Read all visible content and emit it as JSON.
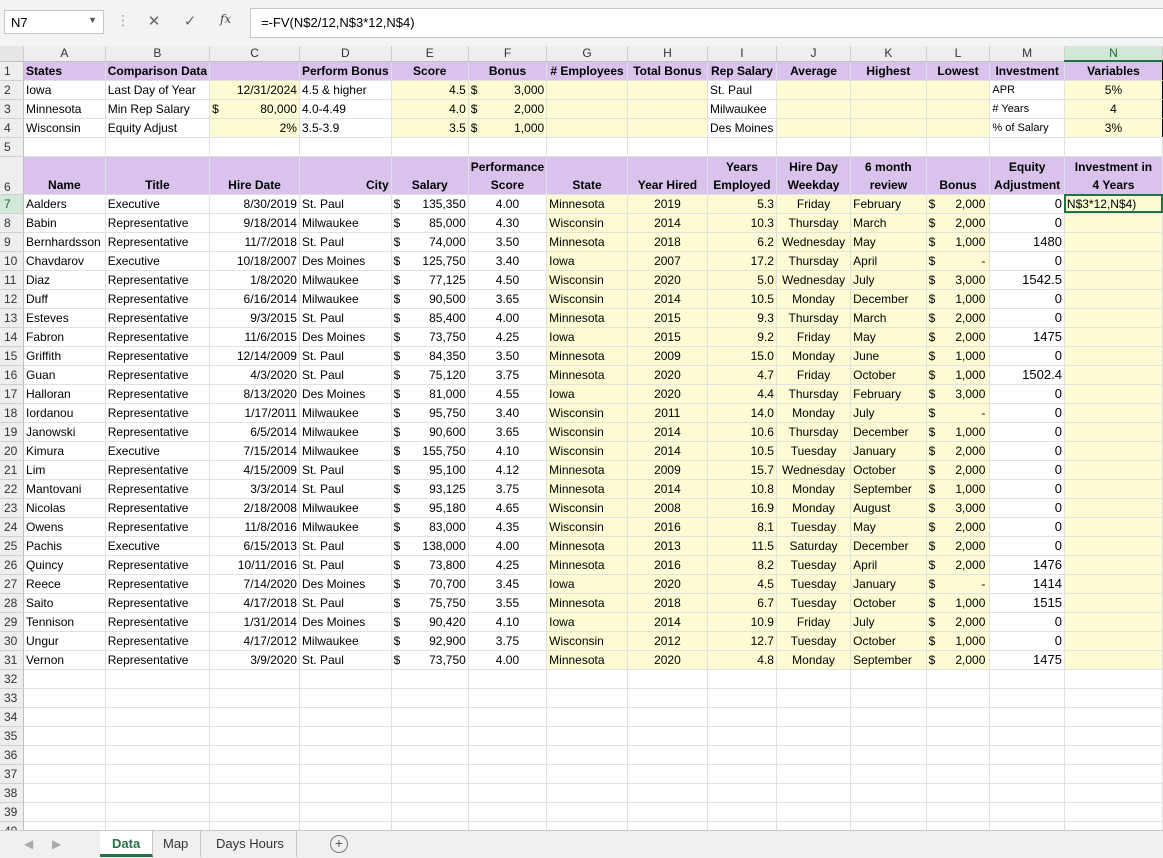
{
  "formula_bar": {
    "name_box": "N7",
    "formula": "=-FV(N$2/12,N$3*12,N$4)"
  },
  "columns": [
    "A",
    "B",
    "C",
    "D",
    "E",
    "F",
    "G",
    "H",
    "I",
    "J",
    "K",
    "L",
    "M",
    "N"
  ],
  "selected_column": "N",
  "selected_row": "7",
  "rows": {
    "r1": {
      "a": "States",
      "b": "Comparison Data",
      "d": "Perform Bonus",
      "e": "Score",
      "f": "Bonus",
      "g": "# Employees",
      "h": "Total Bonus",
      "i": "Rep Salary",
      "j": "Average",
      "k": "Highest",
      "l": "Lowest",
      "m": "Investment",
      "n": "Variables"
    },
    "r2": {
      "a": "Iowa",
      "b": "Last Day of Year",
      "c": "12/31/2024",
      "d": "4.5 & higher",
      "e": "4.5",
      "f_sym": "$",
      "f": "3,000",
      "i": "St. Paul",
      "m": "APR",
      "n": "5%"
    },
    "r3": {
      "a": "Minnesota",
      "b": "Min Rep Salary",
      "c_sym": "$",
      "c": "80,000",
      "d": "4.0-4.49",
      "e": "4.0",
      "f_sym": "$",
      "f": "2,000",
      "i": "Milwaukee",
      "m": "# Years",
      "n": "4"
    },
    "r4": {
      "a": "Wisconsin",
      "b": "Equity Adjust",
      "c": "2%",
      "d": "3.5-3.9",
      "e": "3.5",
      "f_sym": "$",
      "f": "1,000",
      "i": "Des Moines",
      "m": "% of Salary",
      "n": "3%"
    }
  },
  "header6": {
    "a": "Name",
    "b": "Title",
    "c": "Hire Date",
    "d": "City",
    "e": "Salary",
    "f1": "Performance",
    "f2": "Score",
    "g": "State",
    "h": "Year Hired",
    "i1": "Years",
    "i2": "Employed",
    "j1": "Hire Day",
    "j2": "Weekday",
    "k1": "6 month",
    "k2": "review",
    "l": "Bonus",
    "m1": "Equity",
    "m2": "Adjustment",
    "n1": "Investment in",
    "n2": "4 Years"
  },
  "data": [
    {
      "row": "7",
      "name": "Aalders",
      "title": "Executive",
      "hire": "8/30/2019",
      "city": "St. Paul",
      "salary": "135,350",
      "score": "4.00",
      "state": "Minnesota",
      "year": "2019",
      "years": "5.3",
      "weekday": "Friday",
      "review": "February",
      "bonus": "2,000",
      "equity": "0",
      "inv": "N$3*12,N$4)"
    },
    {
      "row": "8",
      "name": "Babin",
      "title": "Representative",
      "hire": "9/18/2014",
      "city": "Milwaukee",
      "salary": "85,000",
      "score": "4.30",
      "state": "Wisconsin",
      "year": "2014",
      "years": "10.3",
      "weekday": "Thursday",
      "review": "March",
      "bonus": "2,000",
      "equity": "0",
      "inv": ""
    },
    {
      "row": "9",
      "name": "Bernhardsson",
      "title": "Representative",
      "hire": "11/7/2018",
      "city": "St. Paul",
      "salary": "74,000",
      "score": "3.50",
      "state": "Minnesota",
      "year": "2018",
      "years": "6.2",
      "weekday": "Wednesday",
      "review": "May",
      "bonus": "1,000",
      "equity": "1480",
      "inv": ""
    },
    {
      "row": "10",
      "name": "Chavdarov",
      "title": "Executive",
      "hire": "10/18/2007",
      "city": "Des Moines",
      "salary": "125,750",
      "score": "3.40",
      "state": "Iowa",
      "year": "2007",
      "years": "17.2",
      "weekday": "Thursday",
      "review": "April",
      "bonus": "-",
      "equity": "0",
      "inv": ""
    },
    {
      "row": "11",
      "name": "Diaz",
      "title": "Representative",
      "hire": "1/8/2020",
      "city": "Milwaukee",
      "salary": "77,125",
      "score": "4.50",
      "state": "Wisconsin",
      "year": "2020",
      "years": "5.0",
      "weekday": "Wednesday",
      "review": "July",
      "bonus": "3,000",
      "equity": "1542.5",
      "inv": ""
    },
    {
      "row": "12",
      "name": "Duff",
      "title": "Representative",
      "hire": "6/16/2014",
      "city": "Milwaukee",
      "salary": "90,500",
      "score": "3.65",
      "state": "Wisconsin",
      "year": "2014",
      "years": "10.5",
      "weekday": "Monday",
      "review": "December",
      "bonus": "1,000",
      "equity": "0",
      "inv": ""
    },
    {
      "row": "13",
      "name": "Esteves",
      "title": "Representative",
      "hire": "9/3/2015",
      "city": "St. Paul",
      "salary": "85,400",
      "score": "4.00",
      "state": "Minnesota",
      "year": "2015",
      "years": "9.3",
      "weekday": "Thursday",
      "review": "March",
      "bonus": "2,000",
      "equity": "0",
      "inv": ""
    },
    {
      "row": "14",
      "name": "Fabron",
      "title": "Representative",
      "hire": "11/6/2015",
      "city": "Des Moines",
      "salary": "73,750",
      "score": "4.25",
      "state": "Iowa",
      "year": "2015",
      "years": "9.2",
      "weekday": "Friday",
      "review": "May",
      "bonus": "2,000",
      "equity": "1475",
      "inv": ""
    },
    {
      "row": "15",
      "name": "Griffith",
      "title": "Representative",
      "hire": "12/14/2009",
      "city": "St. Paul",
      "salary": "84,350",
      "score": "3.50",
      "state": "Minnesota",
      "year": "2009",
      "years": "15.0",
      "weekday": "Monday",
      "review": "June",
      "bonus": "1,000",
      "equity": "0",
      "inv": ""
    },
    {
      "row": "16",
      "name": "Guan",
      "title": "Representative",
      "hire": "4/3/2020",
      "city": "St. Paul",
      "salary": "75,120",
      "score": "3.75",
      "state": "Minnesota",
      "year": "2020",
      "years": "4.7",
      "weekday": "Friday",
      "review": "October",
      "bonus": "1,000",
      "equity": "1502.4",
      "inv": ""
    },
    {
      "row": "17",
      "name": "Halloran",
      "title": "Representative",
      "hire": "8/13/2020",
      "city": "Des Moines",
      "salary": "81,000",
      "score": "4.55",
      "state": "Iowa",
      "year": "2020",
      "years": "4.4",
      "weekday": "Thursday",
      "review": "February",
      "bonus": "3,000",
      "equity": "0",
      "inv": ""
    },
    {
      "row": "18",
      "name": "Iordanou",
      "title": "Representative",
      "hire": "1/17/2011",
      "city": "Milwaukee",
      "salary": "95,750",
      "score": "3.40",
      "state": "Wisconsin",
      "year": "2011",
      "years": "14.0",
      "weekday": "Monday",
      "review": "July",
      "bonus": "-",
      "equity": "0",
      "inv": ""
    },
    {
      "row": "19",
      "name": "Janowski",
      "title": "Representative",
      "hire": "6/5/2014",
      "city": "Milwaukee",
      "salary": "90,600",
      "score": "3.65",
      "state": "Wisconsin",
      "year": "2014",
      "years": "10.6",
      "weekday": "Thursday",
      "review": "December",
      "bonus": "1,000",
      "equity": "0",
      "inv": ""
    },
    {
      "row": "20",
      "name": "Kimura",
      "title": "Executive",
      "hire": "7/15/2014",
      "city": "Milwaukee",
      "salary": "155,750",
      "score": "4.10",
      "state": "Wisconsin",
      "year": "2014",
      "years": "10.5",
      "weekday": "Tuesday",
      "review": "January",
      "bonus": "2,000",
      "equity": "0",
      "inv": ""
    },
    {
      "row": "21",
      "name": "Lim",
      "title": "Representative",
      "hire": "4/15/2009",
      "city": "St. Paul",
      "salary": "95,100",
      "score": "4.12",
      "state": "Minnesota",
      "year": "2009",
      "years": "15.7",
      "weekday": "Wednesday",
      "review": "October",
      "bonus": "2,000",
      "equity": "0",
      "inv": ""
    },
    {
      "row": "22",
      "name": "Mantovani",
      "title": "Representative",
      "hire": "3/3/2014",
      "city": "St. Paul",
      "salary": "93,125",
      "score": "3.75",
      "state": "Minnesota",
      "year": "2014",
      "years": "10.8",
      "weekday": "Monday",
      "review": "September",
      "bonus": "1,000",
      "equity": "0",
      "inv": ""
    },
    {
      "row": "23",
      "name": "Nicolas",
      "title": "Representative",
      "hire": "2/18/2008",
      "city": "Milwaukee",
      "salary": "95,180",
      "score": "4.65",
      "state": "Wisconsin",
      "year": "2008",
      "years": "16.9",
      "weekday": "Monday",
      "review": "August",
      "bonus": "3,000",
      "equity": "0",
      "inv": ""
    },
    {
      "row": "24",
      "name": "Owens",
      "title": "Representative",
      "hire": "11/8/2016",
      "city": "Milwaukee",
      "salary": "83,000",
      "score": "4.35",
      "state": "Wisconsin",
      "year": "2016",
      "years": "8.1",
      "weekday": "Tuesday",
      "review": "May",
      "bonus": "2,000",
      "equity": "0",
      "inv": ""
    },
    {
      "row": "25",
      "name": "Pachis",
      "title": "Executive",
      "hire": "6/15/2013",
      "city": "St. Paul",
      "salary": "138,000",
      "score": "4.00",
      "state": "Minnesota",
      "year": "2013",
      "years": "11.5",
      "weekday": "Saturday",
      "review": "December",
      "bonus": "2,000",
      "equity": "0",
      "inv": ""
    },
    {
      "row": "26",
      "name": "Quincy",
      "title": "Representative",
      "hire": "10/11/2016",
      "city": "St. Paul",
      "salary": "73,800",
      "score": "4.25",
      "state": "Minnesota",
      "year": "2016",
      "years": "8.2",
      "weekday": "Tuesday",
      "review": "April",
      "bonus": "2,000",
      "equity": "1476",
      "inv": ""
    },
    {
      "row": "27",
      "name": "Reece",
      "title": "Representative",
      "hire": "7/14/2020",
      "city": "Des Moines",
      "salary": "70,700",
      "score": "3.45",
      "state": "Iowa",
      "year": "2020",
      "years": "4.5",
      "weekday": "Tuesday",
      "review": "January",
      "bonus": "-",
      "equity": "1414",
      "inv": ""
    },
    {
      "row": "28",
      "name": "Saito",
      "title": "Representative",
      "hire": "4/17/2018",
      "city": "St. Paul",
      "salary": "75,750",
      "score": "3.55",
      "state": "Minnesota",
      "year": "2018",
      "years": "6.7",
      "weekday": "Tuesday",
      "review": "October",
      "bonus": "1,000",
      "equity": "1515",
      "inv": ""
    },
    {
      "row": "29",
      "name": "Tennison",
      "title": "Representative",
      "hire": "1/31/2014",
      "city": "Des Moines",
      "salary": "90,420",
      "score": "4.10",
      "state": "Iowa",
      "year": "2014",
      "years": "10.9",
      "weekday": "Friday",
      "review": "July",
      "bonus": "2,000",
      "equity": "0",
      "inv": ""
    },
    {
      "row": "30",
      "name": "Ungur",
      "title": "Representative",
      "hire": "4/17/2012",
      "city": "Milwaukee",
      "salary": "92,900",
      "score": "3.75",
      "state": "Wisconsin",
      "year": "2012",
      "years": "12.7",
      "weekday": "Tuesday",
      "review": "October",
      "bonus": "1,000",
      "equity": "0",
      "inv": ""
    },
    {
      "row": "31",
      "name": "Vernon",
      "title": "Representative",
      "hire": "3/9/2020",
      "city": "St. Paul",
      "salary": "73,750",
      "score": "4.00",
      "state": "Minnesota",
      "year": "2020",
      "years": "4.8",
      "weekday": "Monday",
      "review": "September",
      "bonus": "2,000",
      "equity": "1475",
      "inv": ""
    }
  ],
  "currency_symbol": "$",
  "empty_rows": [
    "32",
    "33",
    "34",
    "35",
    "36",
    "37",
    "38",
    "39",
    "40"
  ],
  "sheet_tabs": [
    {
      "label": "Data",
      "active": true
    },
    {
      "label": "Map",
      "active": false
    },
    {
      "label": "Days Hours",
      "active": false
    }
  ],
  "icons": {
    "name_box": "chevron-down-icon",
    "cancel": "close-icon",
    "enter": "check-icon",
    "fx": "function-icon",
    "add_sheet": "plus-circle-icon",
    "prev": "chevron-left-icon",
    "next": "chevron-right-icon"
  },
  "colors": {
    "header_fill": "#d9c3ed",
    "input_fill": "#fdfbd4",
    "selection": "#217346"
  }
}
